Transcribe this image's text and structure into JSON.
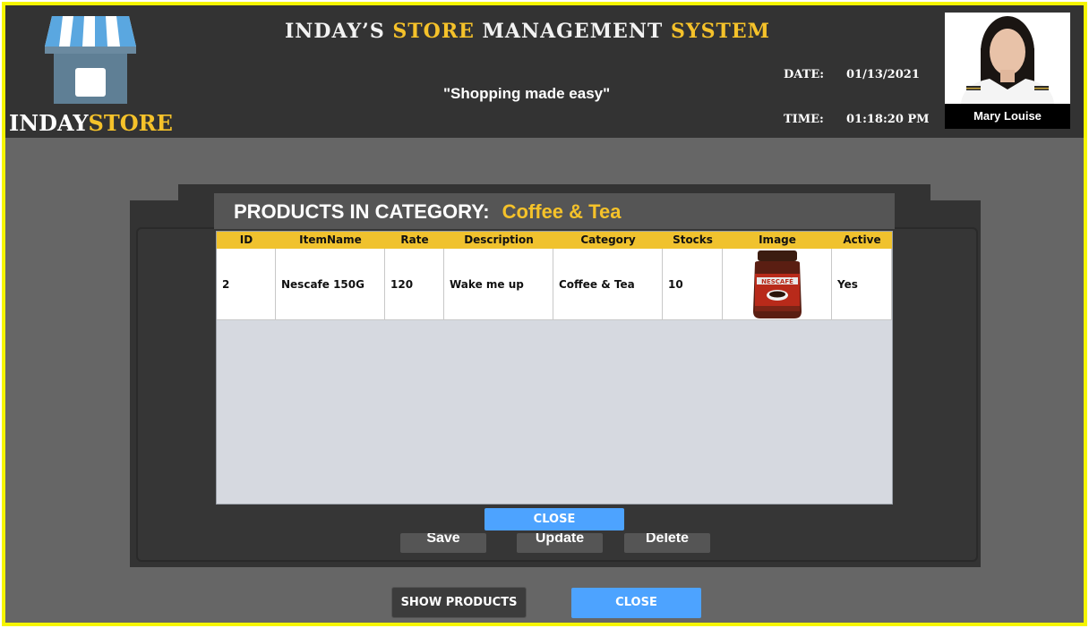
{
  "header": {
    "logo_word1": "INDAY",
    "logo_word2": "STORE",
    "title_part1": "INDAY’S",
    "title_part2": "STORE",
    "title_part3": "MANAGEMENT",
    "title_part4": "SYSTEM",
    "tagline": "\"Shopping made easy\"",
    "date_label": "DATE:",
    "date_value": "01/13/2021",
    "time_label": "TIME:",
    "time_value": "01:18:20 PM",
    "user_name": "Mary Louise"
  },
  "background_form": {
    "buttons": [
      "Save",
      "Update",
      "Delete"
    ]
  },
  "modal": {
    "title_label": "PRODUCTS IN CATEGORY:",
    "category": "Coffee & Tea",
    "columns": [
      "ID",
      "ItemName",
      "Rate",
      "Description",
      "Category",
      "Stocks",
      "Image",
      "Active"
    ],
    "rows": [
      {
        "id": "2",
        "item_name": "Nescafe 150G",
        "rate": "120",
        "description": "Wake me up",
        "category": "Coffee & Tea",
        "stocks": "10",
        "image_icon": "nescafe-jar-image",
        "active": "Yes"
      }
    ],
    "close_label": "CLOSE"
  },
  "footer": {
    "show_products_label": "SHOW PRODUCTS",
    "close_label": "CLOSE"
  },
  "colors": {
    "accent_yellow": "#f5c22a",
    "header_bg": "#333333",
    "button_blue": "#4da3ff",
    "frame_yellow": "#f5f500"
  }
}
